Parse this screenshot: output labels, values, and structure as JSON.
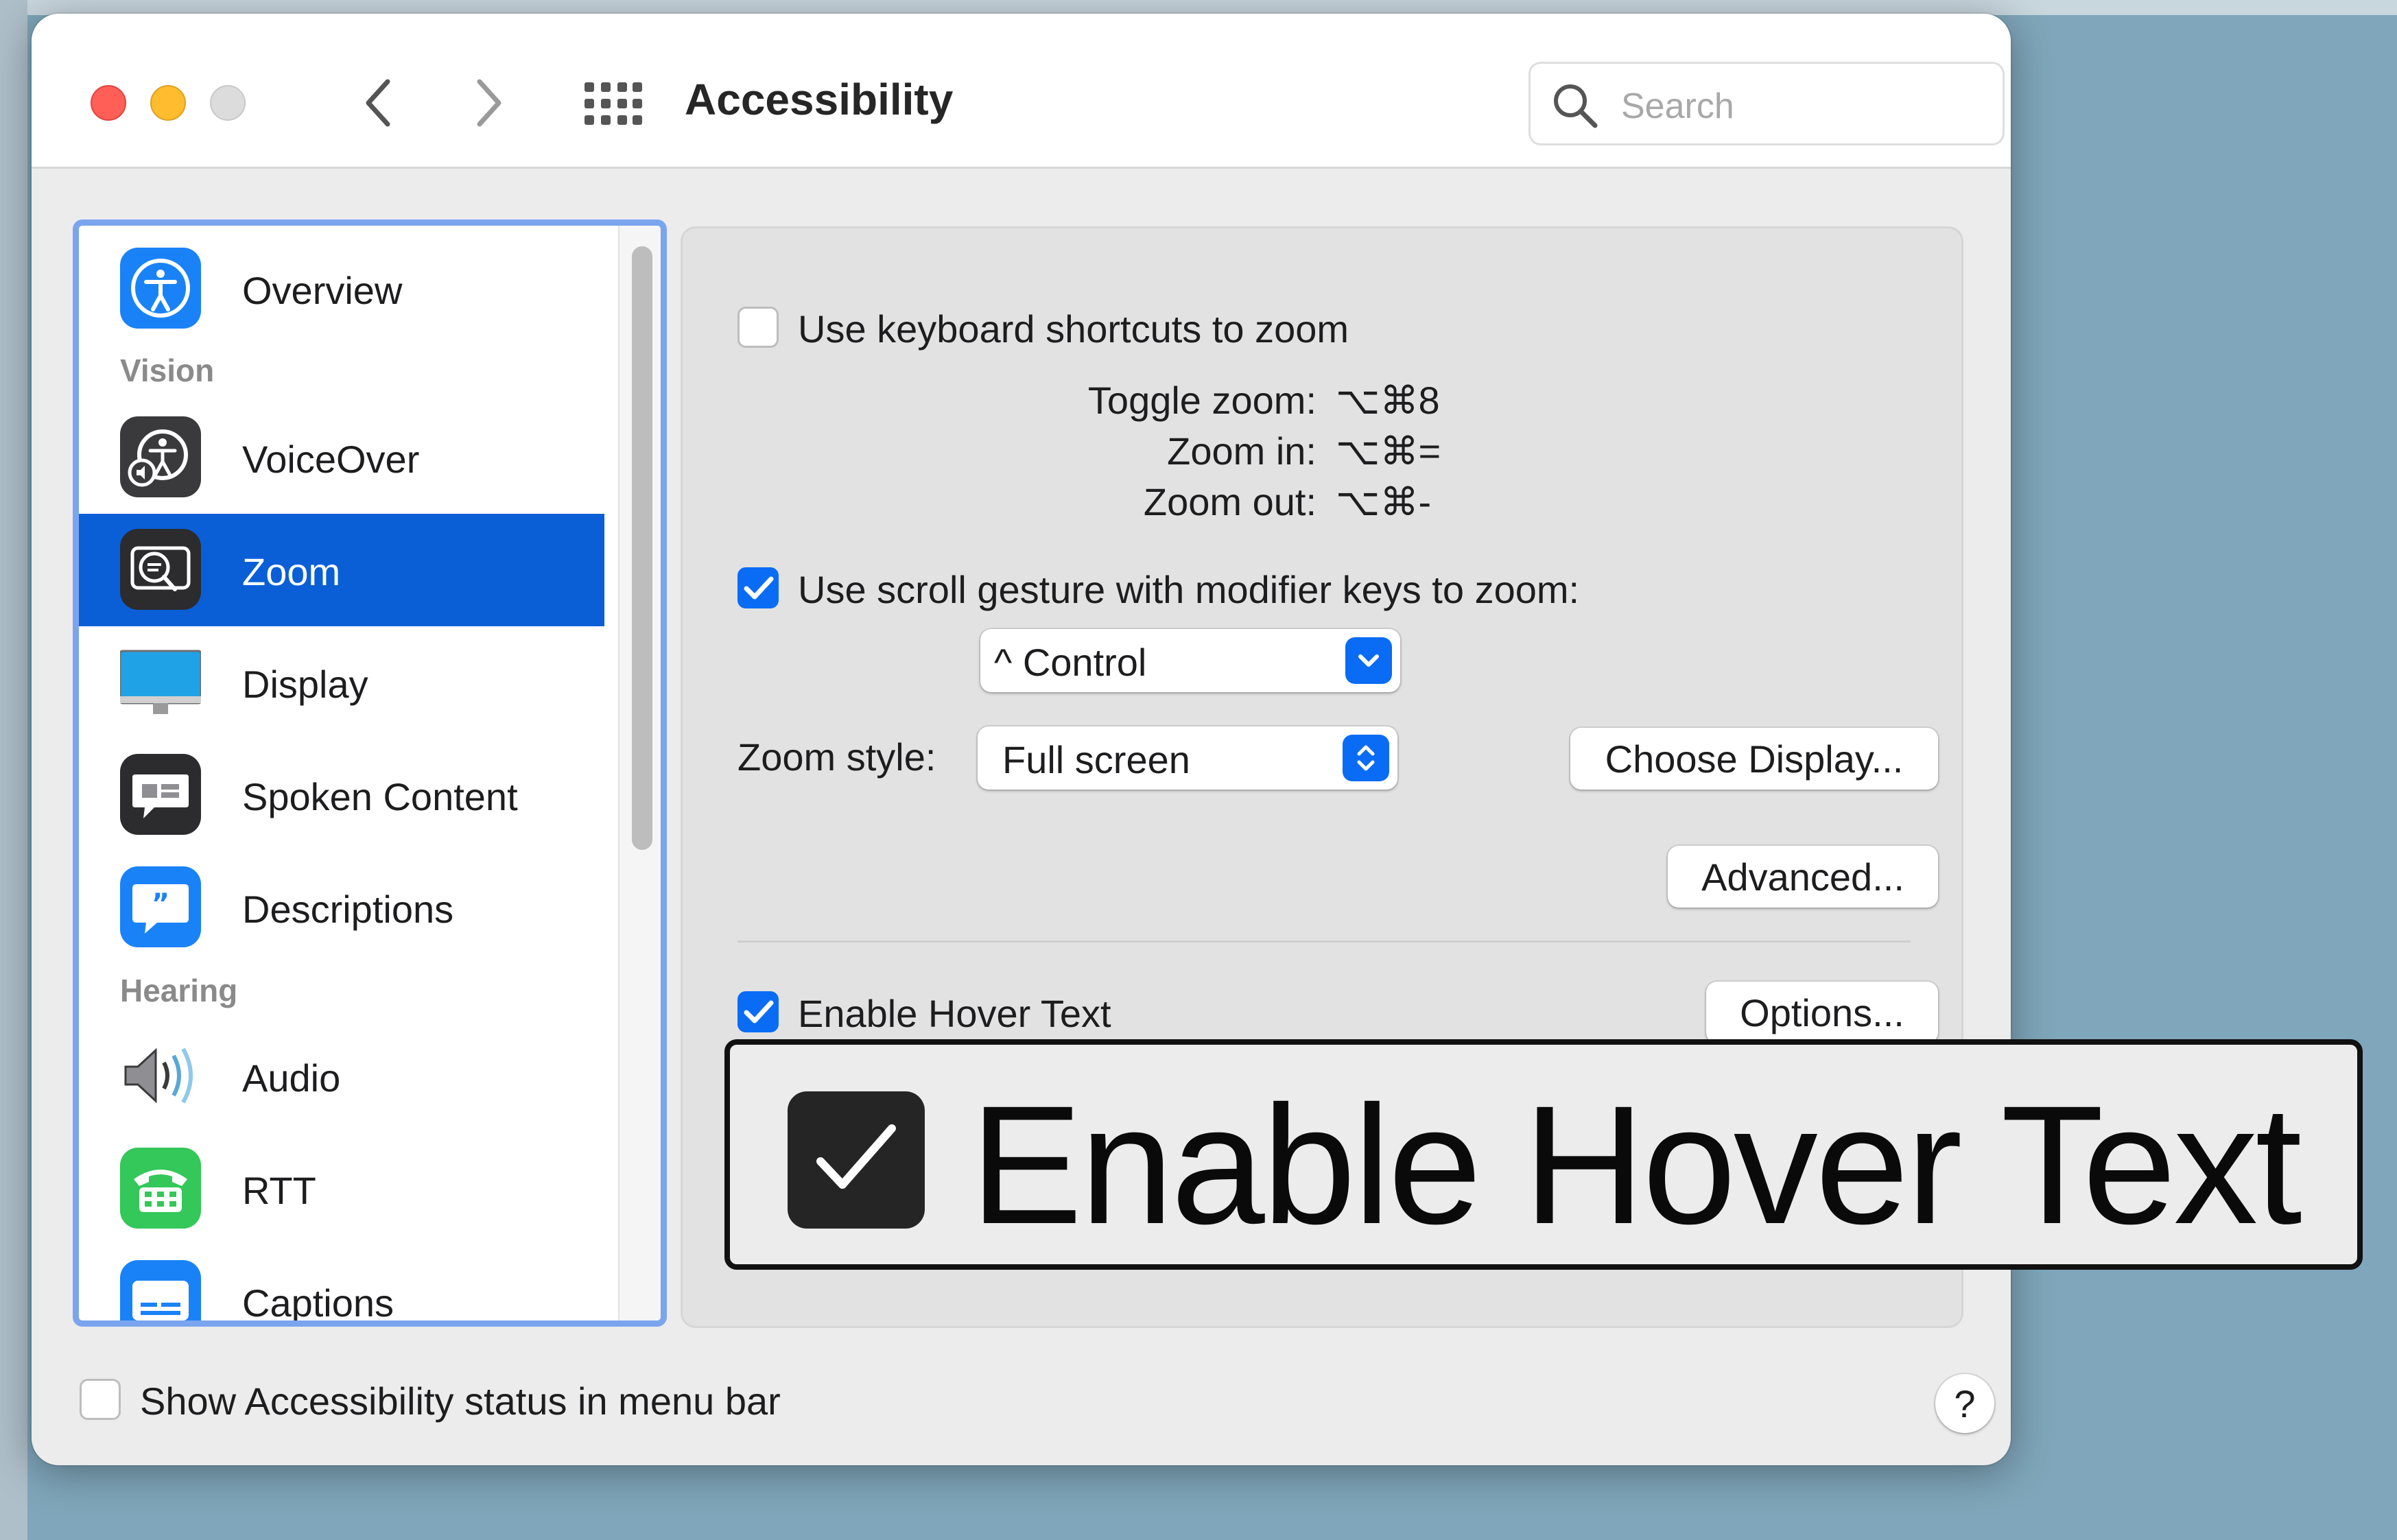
{
  "window": {
    "title": "Accessibility",
    "search_placeholder": "Search"
  },
  "sidebar": {
    "items": [
      {
        "label": "Overview",
        "icon": "accessibility-icon"
      },
      {
        "label": "VoiceOver",
        "icon": "voiceover-icon"
      },
      {
        "label": "Zoom",
        "icon": "zoom-icon",
        "selected": true
      },
      {
        "label": "Display",
        "icon": "display-icon"
      },
      {
        "label": "Spoken Content",
        "icon": "spoken-content-icon"
      },
      {
        "label": "Descriptions",
        "icon": "descriptions-icon"
      },
      {
        "label": "Audio",
        "icon": "audio-icon"
      },
      {
        "label": "RTT",
        "icon": "rtt-icon"
      },
      {
        "label": "Captions",
        "icon": "captions-icon"
      }
    ],
    "headers": {
      "vision": "Vision",
      "hearing": "Hearing"
    }
  },
  "zoom": {
    "keyboard_shortcuts_label": "Use keyboard shortcuts to zoom",
    "keyboard_shortcuts_checked": false,
    "shortcuts": [
      {
        "name": "Toggle zoom:",
        "keys": "⌥⌘8"
      },
      {
        "name": "Zoom in:",
        "keys": "⌥⌘="
      },
      {
        "name": "Zoom out:",
        "keys": "⌥⌘-"
      }
    ],
    "scroll_gesture_label": "Use scroll gesture with modifier keys to zoom:",
    "scroll_gesture_checked": true,
    "modifier_value": "^ Control",
    "zoom_style_label": "Zoom style:",
    "zoom_style_value": "Full screen",
    "choose_display_label": "Choose Display...",
    "advanced_label": "Advanced...",
    "hover_text_label": "Enable Hover Text",
    "hover_text_checked": true,
    "options_label": "Options..."
  },
  "hover_overlay": {
    "text": "Enable Hover Text"
  },
  "footer": {
    "status_menu_label": "Show Accessibility status in menu bar",
    "status_menu_checked": false,
    "help_label": "?"
  },
  "colors": {
    "accent": "#0a6cf5",
    "selection": "#0a5fd6",
    "sidebar_focus": "#7aa5ee"
  }
}
